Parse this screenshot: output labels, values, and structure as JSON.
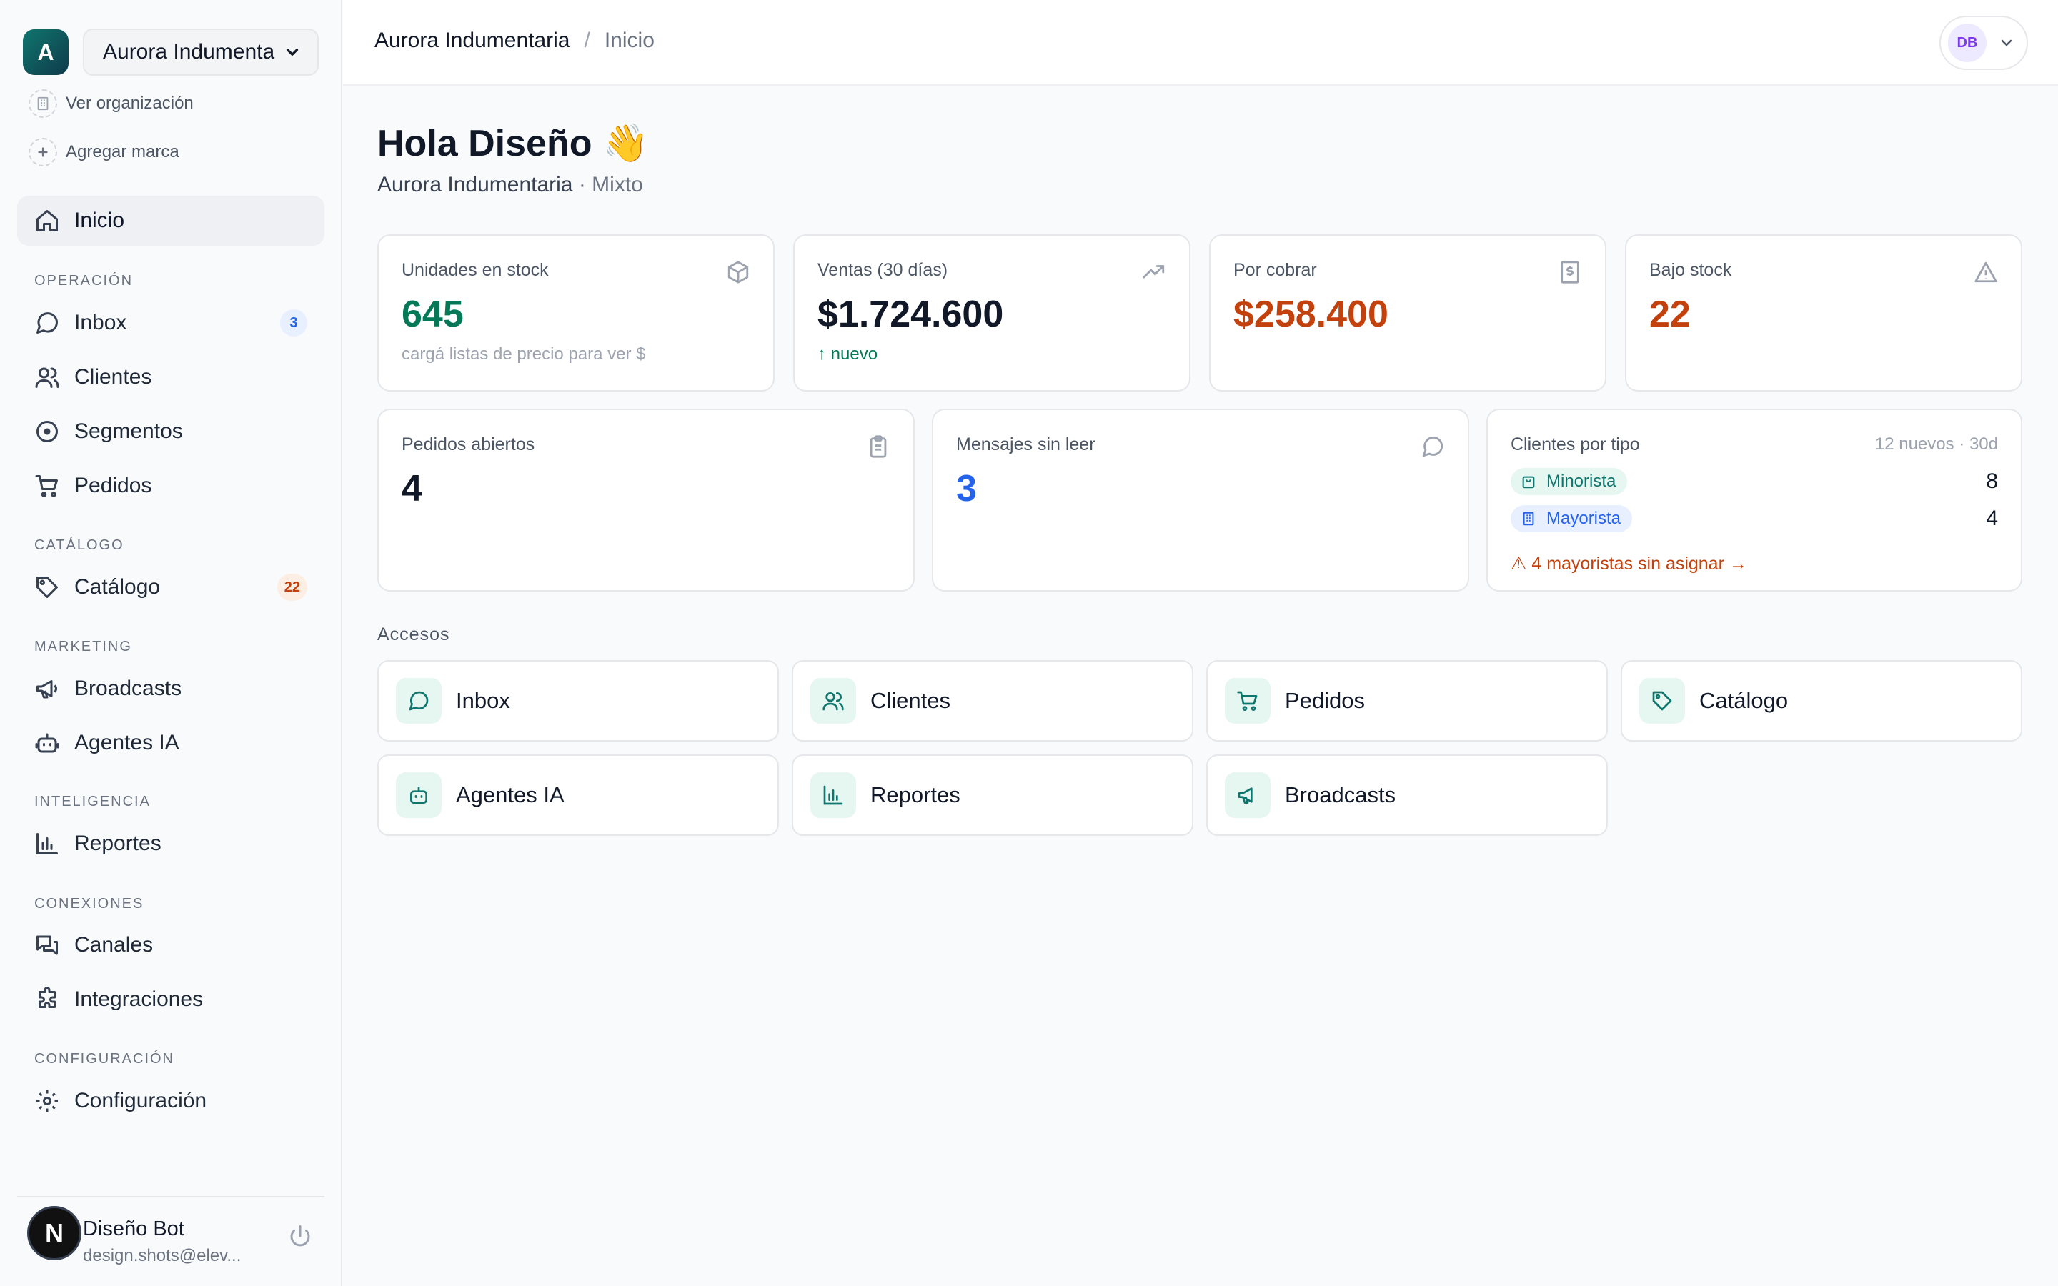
{
  "org": {
    "initial": "A",
    "selected": "Aurora Indumentaria",
    "view_link": "Ver organización",
    "add_brand": "Agregar marca"
  },
  "nav": {
    "home": "Inicio",
    "sections": {
      "operacion": "Operación",
      "catalogo": "Catálogo",
      "marketing": "Marketing",
      "inteligencia": "Inteligencia",
      "conexiones": "Conexiones",
      "configuracion": "Configuración"
    },
    "items": {
      "inbox": {
        "label": "Inbox",
        "badge": "3"
      },
      "clientes": {
        "label": "Clientes"
      },
      "segmentos": {
        "label": "Segmentos"
      },
      "pedidos": {
        "label": "Pedidos"
      },
      "catalogo": {
        "label": "Catálogo",
        "badge": "22"
      },
      "broadcasts": {
        "label": "Broadcasts"
      },
      "agentes": {
        "label": "Agentes IA"
      },
      "reportes": {
        "label": "Reportes"
      },
      "canales": {
        "label": "Canales"
      },
      "integraciones": {
        "label": "Integraciones"
      },
      "configuracion": {
        "label": "Configuración"
      }
    }
  },
  "user": {
    "avatar_letter": "N",
    "name": "Diseño Bot",
    "email": "design.shots@elev..."
  },
  "topbar": {
    "breadcrumb_org": "Aurora Indumentaria",
    "breadcrumb_sep": "/",
    "breadcrumb_current": "Inicio",
    "account_initials": "DB"
  },
  "greeting": {
    "title": "Hola Diseño 👋",
    "org": "Aurora Indumentaria",
    "mode": " · Mixto"
  },
  "stats": {
    "stock": {
      "label": "Unidades en stock",
      "value": "645",
      "note": "cargá listas de precio para ver $"
    },
    "ventas": {
      "label": "Ventas (30 días)",
      "value": "$1.724.600",
      "note": "↑ nuevo"
    },
    "cobrar": {
      "label": "Por cobrar",
      "value": "$258.400"
    },
    "bajo": {
      "label": "Bajo stock",
      "value": "22"
    },
    "pedidos": {
      "label": "Pedidos abiertos",
      "value": "4"
    },
    "mensajes": {
      "label": "Mensajes sin leer",
      "value": "3"
    },
    "clientes_tipo": {
      "label": "Clientes por tipo",
      "meta": "12 nuevos · 30d",
      "minorista_label": "Minorista",
      "minorista_count": "8",
      "mayorista_label": "Mayorista",
      "mayorista_count": "4",
      "warning": "⚠ 4 mayoristas sin asignar →"
    }
  },
  "accesos": {
    "title": "Accesos",
    "tiles": {
      "inbox": "Inbox",
      "clientes": "Clientes",
      "pedidos": "Pedidos",
      "catalogo": "Catálogo",
      "agentes": "Agentes IA",
      "reportes": "Reportes",
      "broadcasts": "Broadcasts"
    }
  },
  "colors": {
    "accent_teal": "#0f766e",
    "positive": "#047857",
    "warning": "#c2410c",
    "info": "#2563eb"
  }
}
